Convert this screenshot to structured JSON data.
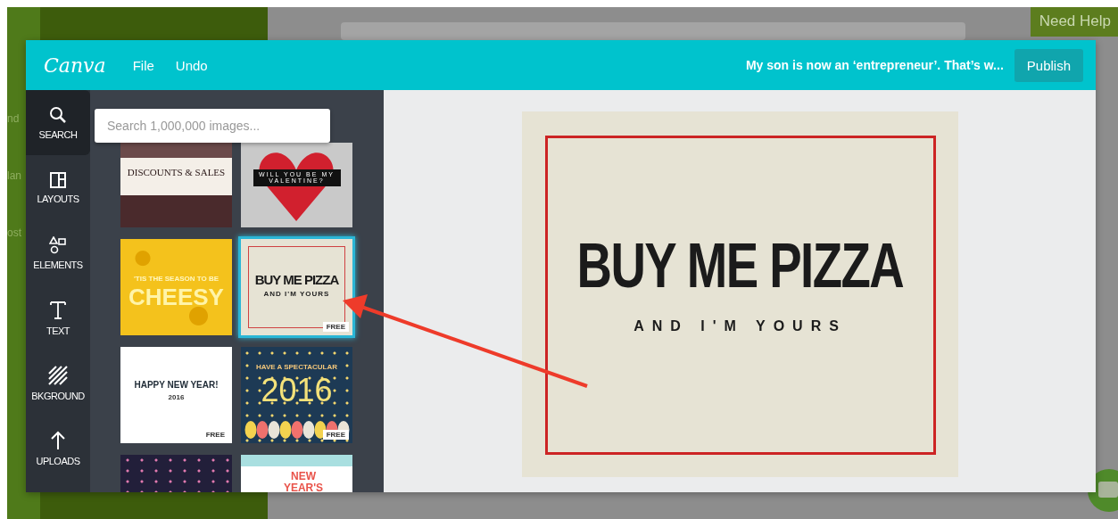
{
  "background": {
    "sidebar_labels": [
      "nd",
      "lan",
      "ost"
    ],
    "help_tab": "Need Help"
  },
  "header": {
    "logo": "Canva",
    "menu": [
      "File",
      "Undo"
    ],
    "design_title": "My son is now an ‘entrepreneur’. That’s w...",
    "publish": "Publish"
  },
  "nav": [
    {
      "label": "SEARCH",
      "kind": "search",
      "selected": true
    },
    {
      "label": "LAYOUTS",
      "kind": "layouts",
      "selected": false
    },
    {
      "label": "ELEMENTS",
      "kind": "elements",
      "selected": false
    },
    {
      "label": "TEXT",
      "kind": "text",
      "selected": false
    },
    {
      "label": "BKGROUND",
      "kind": "background",
      "selected": false
    },
    {
      "label": "UPLOADS",
      "kind": "uploads",
      "selected": false
    }
  ],
  "search": {
    "placeholder": "Search 1,000,000 images..."
  },
  "templates": [
    {
      "kind": "sale",
      "title": "DISCOUNTS & SALES",
      "selected": false
    },
    {
      "kind": "heart",
      "title": "WILL YOU BE MY VALENTINE?",
      "selected": false
    },
    {
      "kind": "cheese",
      "subtitle": "'TIS THE SEASON TO BE",
      "title": "CHEESY",
      "selected": false
    },
    {
      "kind": "pizza",
      "title": "BUY ME PIZZA",
      "subtitle": "AND I'M YOURS",
      "badge": "FREE",
      "selected": true
    },
    {
      "kind": "newyear",
      "title": "HAPPY NEW YEAR!",
      "subtitle": "2016",
      "badge": "FREE",
      "selected": false
    },
    {
      "kind": "spectacular",
      "subtitle": "HAVE A SPECTACULAR",
      "title": "2016",
      "badge": "FREE",
      "selected": false
    },
    {
      "kind": "fireworks",
      "selected": false
    },
    {
      "kind": "newyears",
      "title": "NEW YEAR'S",
      "selected": false
    }
  ],
  "design": {
    "headline": "BUY ME PIZZA",
    "tagline": "AND I'M YOURS"
  }
}
